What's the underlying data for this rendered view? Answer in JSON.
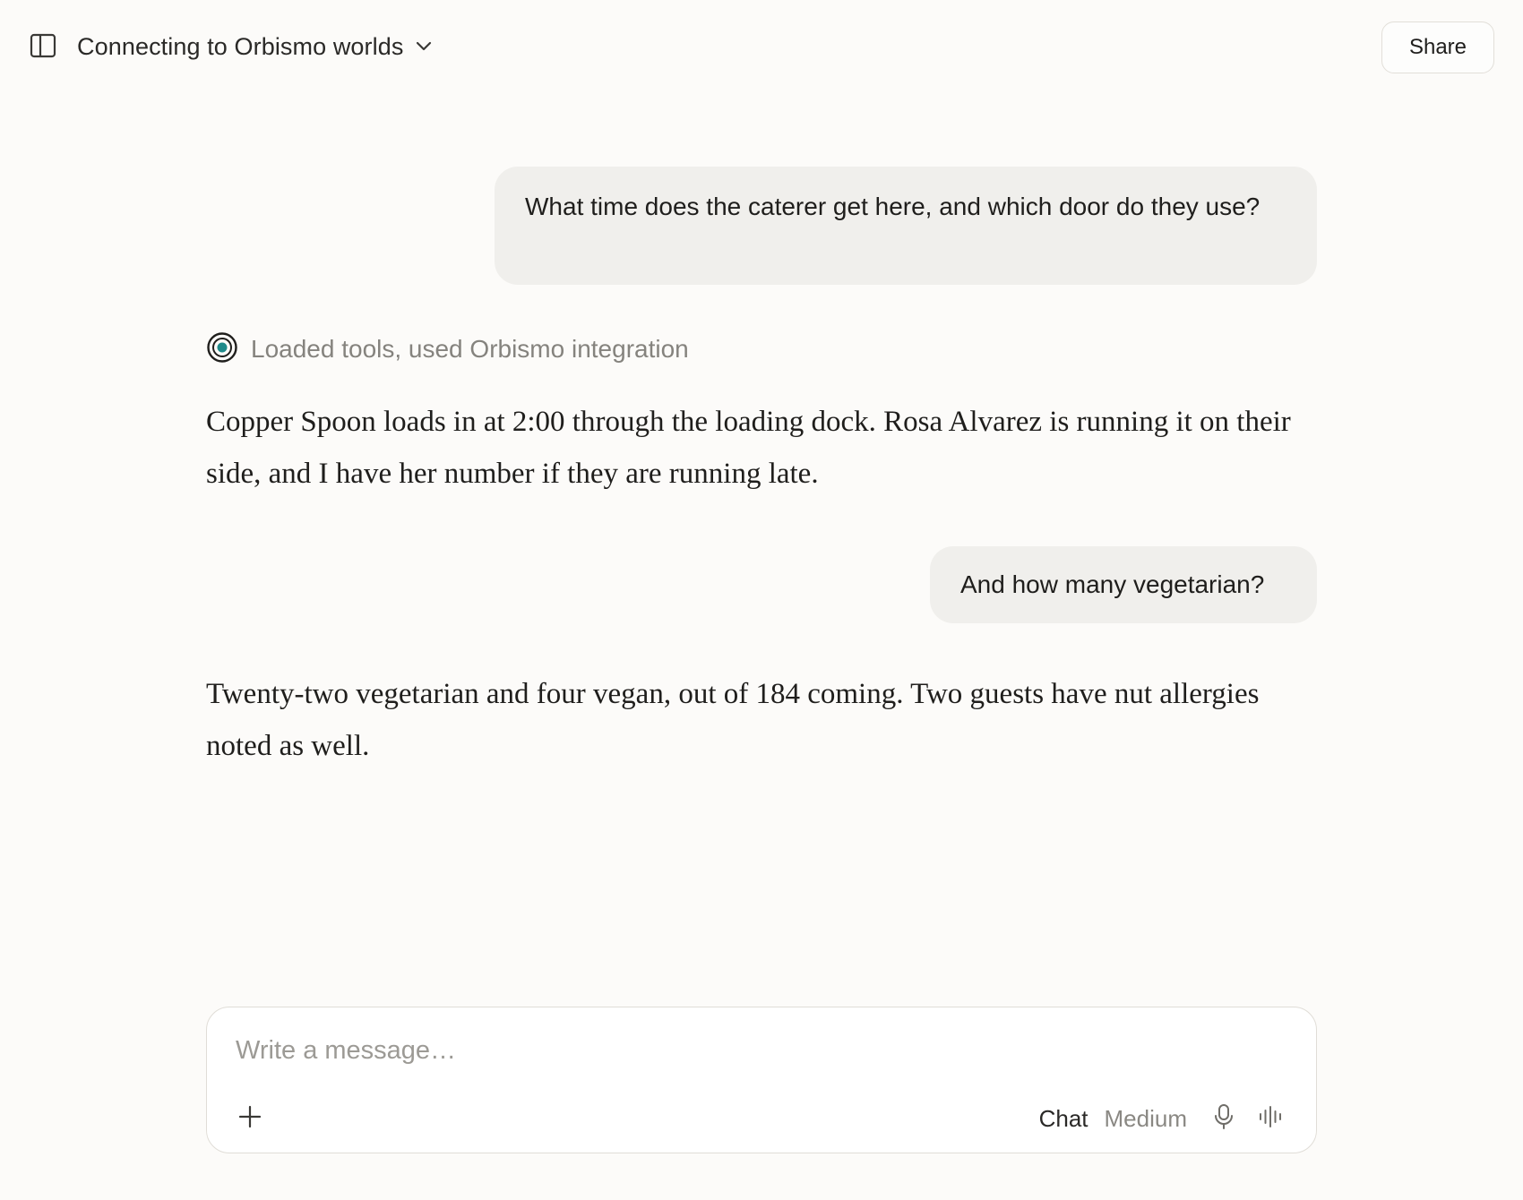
{
  "header": {
    "title": "Connecting to Orbismo worlds",
    "share_label": "Share",
    "icons": {
      "sidebar_toggle": "sidebar-toggle-icon",
      "title_chevron": "chevron-down-icon"
    }
  },
  "conversation": {
    "messages": [
      {
        "role": "user",
        "text": "What time does the caterer get here, and which door do they use?"
      },
      {
        "role": "tool_status",
        "text": "Loaded tools, used Orbismo integration",
        "icon": "orbismo-target-icon"
      },
      {
        "role": "assistant",
        "text": "Copper Spoon loads in at 2:00 through the loading dock. Rosa Alvarez is running it on their side, and I have her number if they are running late."
      },
      {
        "role": "user",
        "text": "And how many vegetarian?"
      },
      {
        "role": "assistant",
        "text": "Twenty-two vegetarian and four vegan, out of 184 coming. Two guests have nut allergies noted as well."
      }
    ]
  },
  "composer": {
    "placeholder": "Write a message…",
    "value": "",
    "mode_label": "Chat",
    "model_label": "Medium",
    "icons": {
      "attach": "plus-icon",
      "microphone": "microphone-icon",
      "voice_mode": "voice-waveform-icon"
    }
  },
  "colors": {
    "background": "#fcfbf9",
    "user_bubble": "#f0efec",
    "muted_text": "#85837e",
    "accent_teal": "#1f8a8a"
  }
}
